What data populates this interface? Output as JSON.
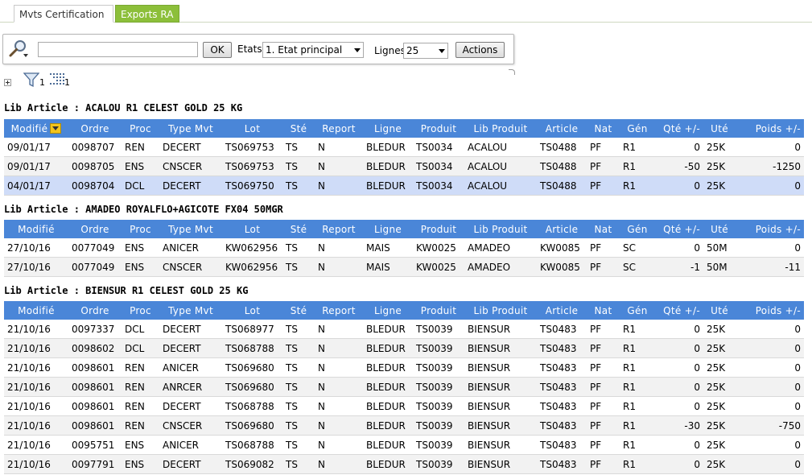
{
  "tabs": [
    {
      "label": "Mvts Certification"
    },
    {
      "label": "Exports RA"
    }
  ],
  "toolbar": {
    "search_value": "",
    "ok_label": "OK",
    "etats_label": "Etats",
    "etats_value": "1. Etat principal",
    "lignes_label": "Lignes",
    "lignes_value": "25",
    "actions_label": "Actions"
  },
  "filters": {
    "filter_count": "1",
    "column_count": "1"
  },
  "columns": [
    "Modifié",
    "Ordre",
    "Proc",
    "Type Mvt",
    "Lot",
    "Sté",
    "Report",
    "Ligne",
    "Produit",
    "Lib Produit",
    "Article",
    "Nat",
    "Gén",
    "Qté +/-",
    "Uté",
    "Poids +/-"
  ],
  "groups": [
    {
      "title": "Lib Article : ACALOU R1 CELEST GOLD 25 KG",
      "rows": [
        [
          "09/01/17",
          "0098707",
          "REN",
          "DECERT",
          "TS069753",
          "TS",
          "N",
          "BLEDUR",
          "TS0034",
          "ACALOU",
          "TS0488",
          "PF",
          "R1",
          "0",
          "25K",
          "0"
        ],
        [
          "09/01/17",
          "0098705",
          "ENS",
          "CNSCER",
          "TS069753",
          "TS",
          "N",
          "BLEDUR",
          "TS0034",
          "ACALOU",
          "TS0488",
          "PF",
          "R1",
          "-50",
          "25K",
          "-1250"
        ],
        [
          "04/01/17",
          "0098704",
          "DCL",
          "DECERT",
          "TS069750",
          "TS",
          "N",
          "BLEDUR",
          "TS0034",
          "ACALOU",
          "TS0488",
          "PF",
          "R1",
          "0",
          "25K",
          "0"
        ]
      ]
    },
    {
      "title": "Lib Article : AMADEO ROYALFLO+AGICOTE FX04 50MGR",
      "rows": [
        [
          "27/10/16",
          "0077049",
          "ENS",
          "ANICER",
          "KW062956",
          "TS",
          "N",
          "MAIS",
          "KW0025",
          "AMADEO",
          "KW0085",
          "PF",
          "SC",
          "0",
          "50M",
          "0"
        ],
        [
          "27/10/16",
          "0077049",
          "ENS",
          "CNSCER",
          "KW062956",
          "TS",
          "N",
          "MAIS",
          "KW0025",
          "AMADEO",
          "KW0085",
          "PF",
          "SC",
          "-1",
          "50M",
          "-11"
        ]
      ]
    },
    {
      "title": "Lib Article : BIENSUR R1 CELEST GOLD 25 KG",
      "rows": [
        [
          "21/10/16",
          "0097337",
          "DCL",
          "DECERT",
          "TS068977",
          "TS",
          "N",
          "BLEDUR",
          "TS0039",
          "BIENSUR",
          "TS0483",
          "PF",
          "R1",
          "0",
          "25K",
          "0"
        ],
        [
          "21/10/16",
          "0098602",
          "DCL",
          "DECERT",
          "TS068788",
          "TS",
          "N",
          "BLEDUR",
          "TS0039",
          "BIENSUR",
          "TS0483",
          "PF",
          "R1",
          "0",
          "25K",
          "0"
        ],
        [
          "21/10/16",
          "0098601",
          "REN",
          "ANICER",
          "TS069680",
          "TS",
          "N",
          "BLEDUR",
          "TS0039",
          "BIENSUR",
          "TS0483",
          "PF",
          "R1",
          "0",
          "25K",
          "0"
        ],
        [
          "21/10/16",
          "0098601",
          "REN",
          "ANRCER",
          "TS069680",
          "TS",
          "N",
          "BLEDUR",
          "TS0039",
          "BIENSUR",
          "TS0483",
          "PF",
          "R1",
          "0",
          "25K",
          "0"
        ],
        [
          "21/10/16",
          "0098601",
          "REN",
          "DECERT",
          "TS068788",
          "TS",
          "N",
          "BLEDUR",
          "TS0039",
          "BIENSUR",
          "TS0483",
          "PF",
          "R1",
          "0",
          "25K",
          "0"
        ],
        [
          "21/10/16",
          "0098601",
          "REN",
          "CNSCER",
          "TS069680",
          "TS",
          "N",
          "BLEDUR",
          "TS0039",
          "BIENSUR",
          "TS0483",
          "PF",
          "R1",
          "-30",
          "25K",
          "-750"
        ],
        [
          "21/10/16",
          "0095751",
          "ENS",
          "ANICER",
          "TS068788",
          "TS",
          "N",
          "BLEDUR",
          "TS0039",
          "BIENSUR",
          "TS0483",
          "PF",
          "R1",
          "0",
          "25K",
          "0"
        ],
        [
          "21/10/16",
          "0097791",
          "ENS",
          "DECERT",
          "TS069082",
          "TS",
          "N",
          "BLEDUR",
          "TS0039",
          "BIENSUR",
          "TS0483",
          "PF",
          "R1",
          "0",
          "25K",
          "0"
        ]
      ]
    }
  ],
  "colors": {
    "header_bg": "#4a86d8",
    "tab_inactive_bg": "#8cbf3a",
    "selected_row_bg": "#cfdcf8"
  }
}
